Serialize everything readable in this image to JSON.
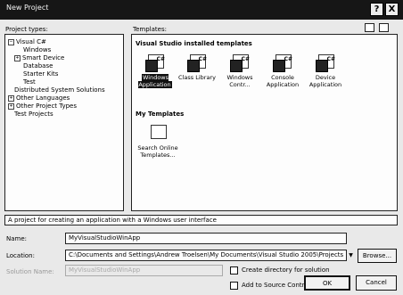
{
  "window": {
    "title": "New Project",
    "help_glyph": "?",
    "close_glyph": "X"
  },
  "project_types": {
    "label": "Project types:",
    "items": [
      {
        "label": "Visual C#",
        "toggle": "−"
      },
      {
        "label": "Windows"
      },
      {
        "label": "Smart Device",
        "toggle": "+"
      },
      {
        "label": "Database"
      },
      {
        "label": "Starter Kits"
      },
      {
        "label": "Test"
      },
      {
        "label": "Distributed System Solutions"
      },
      {
        "label": "Other Languages",
        "toggle": "+"
      },
      {
        "label": "Other Project Types",
        "toggle": "+"
      },
      {
        "label": "Test Projects"
      }
    ]
  },
  "templates": {
    "label": "Templates:",
    "installed_heading": "Visual Studio installed templates",
    "installed": [
      {
        "label": "Windows Application",
        "badge": "C#"
      },
      {
        "label": "Class Library",
        "badge": "C#"
      },
      {
        "label": "Windows Contr...",
        "badge": "C#"
      },
      {
        "label": "Console Application",
        "badge": "C#"
      },
      {
        "label": "Device Application",
        "badge": "C#"
      }
    ],
    "my_heading": "My Templates",
    "my": [
      {
        "label": "Search Online Templates..."
      }
    ]
  },
  "description": "A project for creating an application with a Windows user interface",
  "form": {
    "name_label": "Name:",
    "name_value": "MyVisualStudioWinApp",
    "location_label": "Location:",
    "location_value": "C:\\Documents and Settings\\Andrew Troelsen\\My Documents\\Visual Studio 2005\\Projects",
    "solution_label": "Solution Name:",
    "solution_value": "MyVisualStudioWinApp",
    "browse_label": "Browse...",
    "create_dir_label": "Create directory for solution",
    "source_control_label": "Add to Source Control"
  },
  "buttons": {
    "ok": "OK",
    "cancel": "Cancel"
  }
}
